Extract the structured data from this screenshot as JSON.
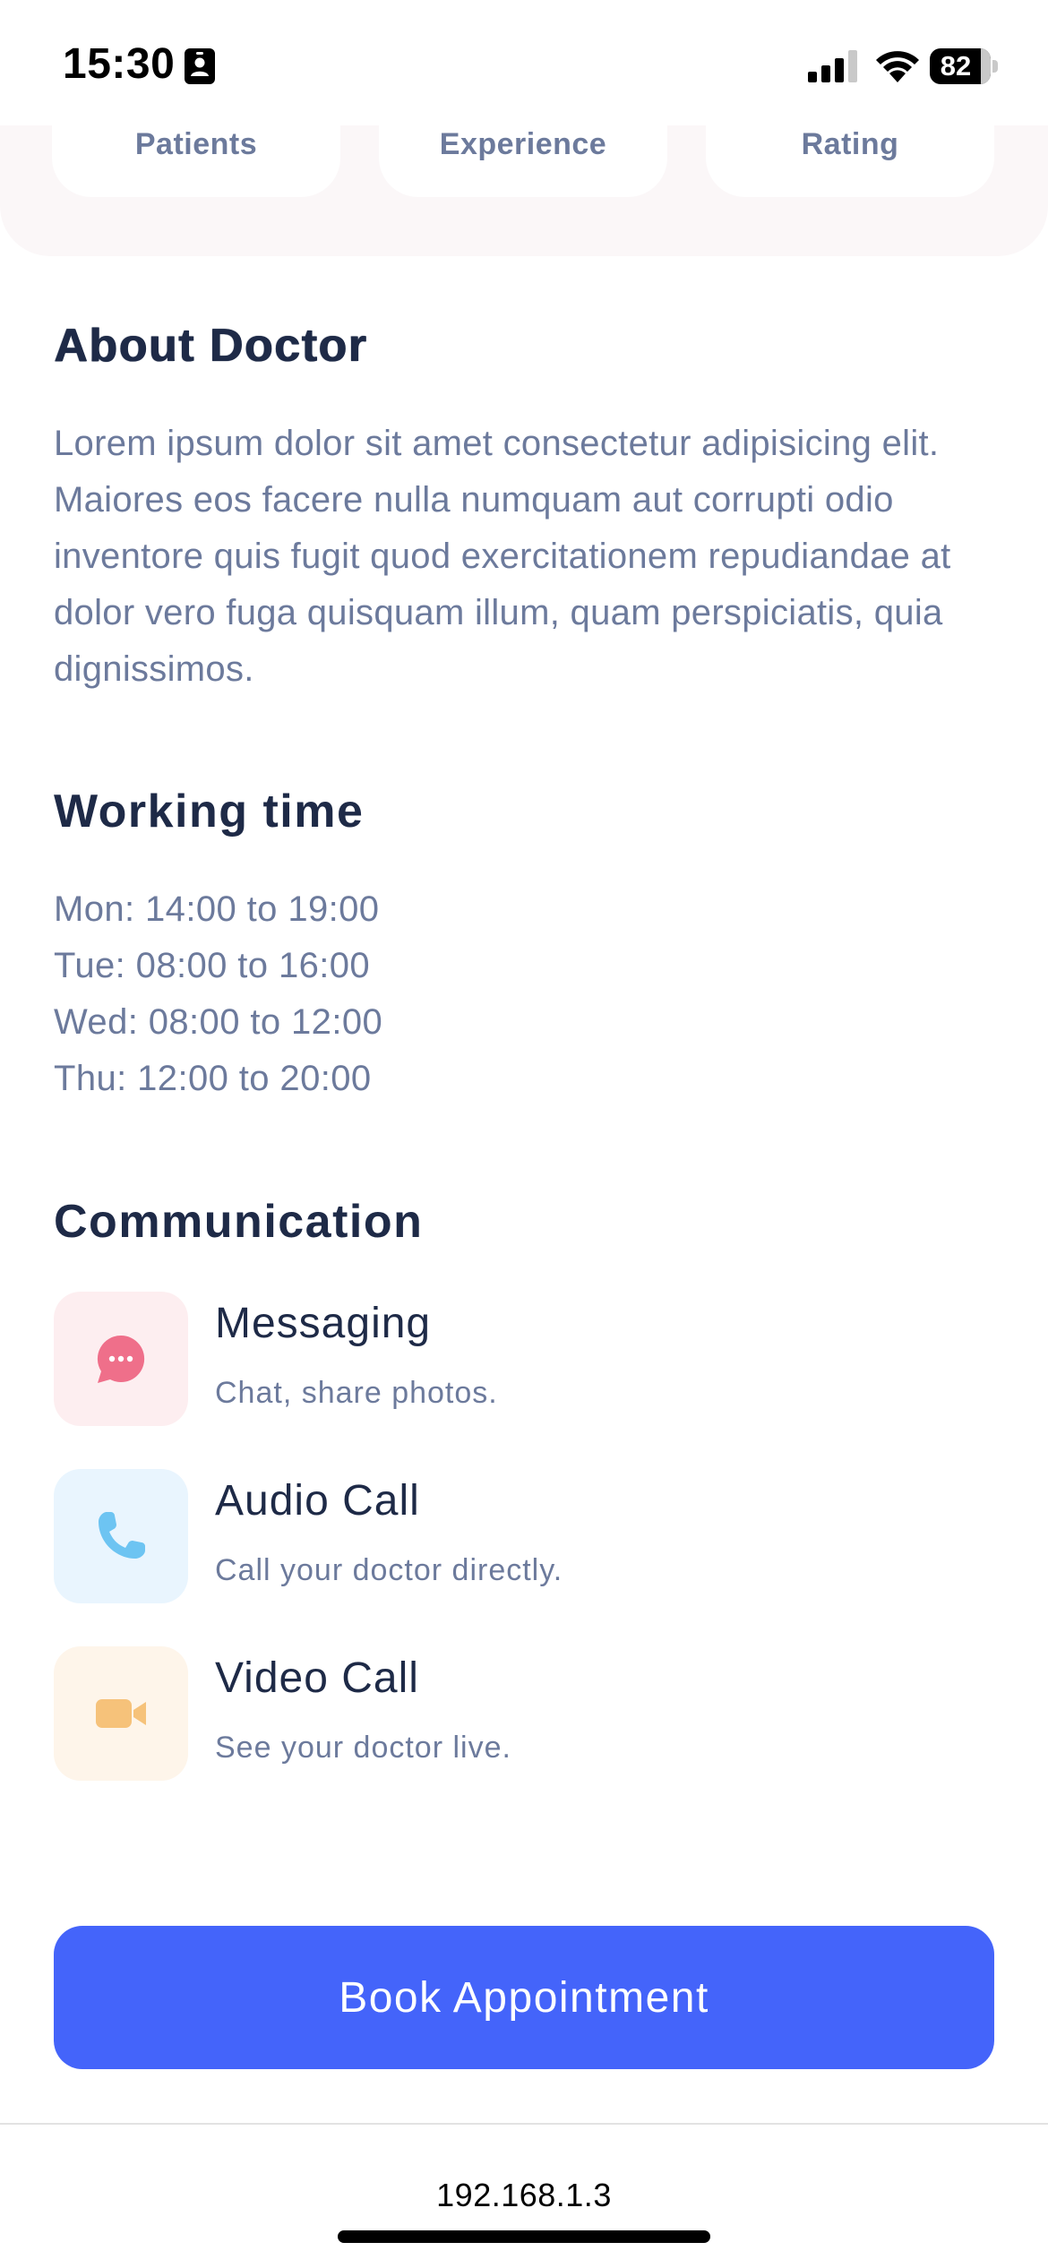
{
  "status_bar": {
    "time": "15:30",
    "battery": "82",
    "icons": [
      "contact-card-icon",
      "cellular-signal-icon",
      "wifi-icon",
      "battery-icon"
    ]
  },
  "stats": {
    "items": [
      {
        "label": "Patients"
      },
      {
        "label": "Experience"
      },
      {
        "label": "Rating"
      }
    ]
  },
  "about": {
    "title": "About Doctor",
    "text": "Lorem ipsum dolor sit amet consectetur adipisicing elit. Maiores eos facere nulla numquam aut corrupti odio inventore quis fugit quod exercitationem repudiandae at dolor vero fuga quisquam illum, quam perspiciatis, quia dignissimos."
  },
  "working_time": {
    "title": "Working time",
    "hours": [
      "Mon: 14:00 to 19:00",
      "Tue: 08:00 to 16:00",
      "Wed: 08:00 to 12:00",
      "Thu: 12:00 to 20:00"
    ]
  },
  "communication": {
    "title": "Communication",
    "items": [
      {
        "name": "Messaging",
        "description": "Chat, share photos.",
        "icon": "chat-bubble-icon",
        "icon_color": "#ef6f8a",
        "bg_color": "#fdeef0"
      },
      {
        "name": "Audio Call",
        "description": "Call your doctor directly.",
        "icon": "phone-icon",
        "icon_color": "#6dc4f2",
        "bg_color": "#e9f5fe"
      },
      {
        "name": "Video Call",
        "description": "See your doctor live.",
        "icon": "video-camera-icon",
        "icon_color": "#f6c27a",
        "bg_color": "#fef5ea"
      }
    ]
  },
  "book_button": {
    "label": "Book Appointment",
    "color": "#4464fa"
  },
  "browser": {
    "url": "192.168.1.3"
  }
}
